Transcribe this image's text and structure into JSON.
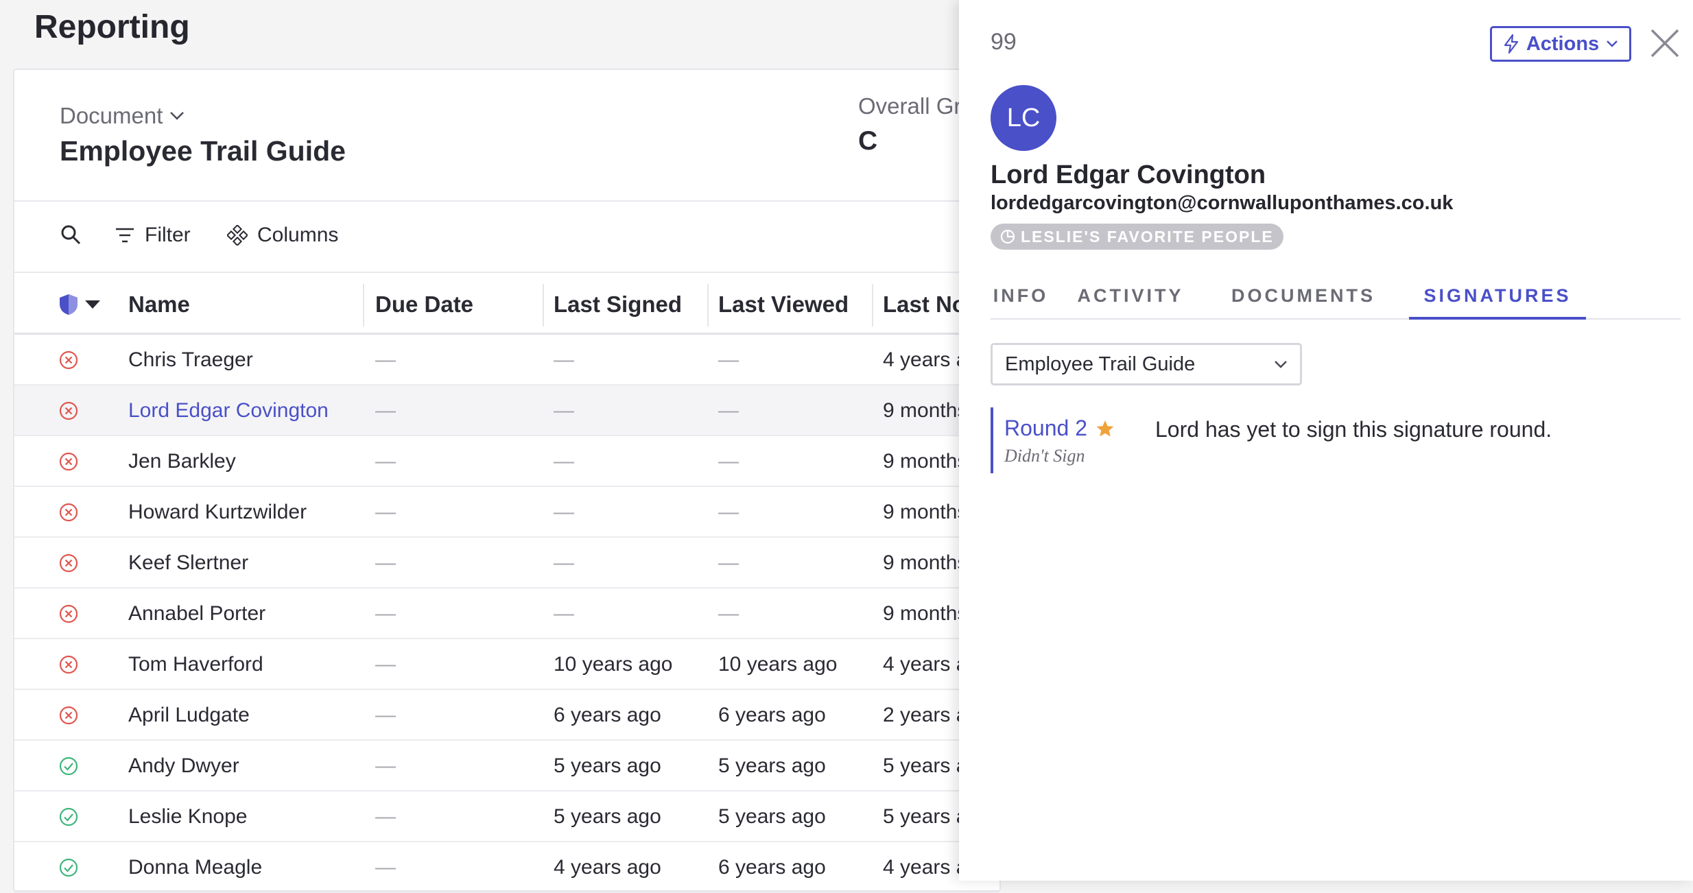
{
  "page": {
    "title": "Reporting"
  },
  "document": {
    "label": "Document",
    "title": "Employee Trail Guide",
    "grade_label": "Overall Gr",
    "grade_value": "C"
  },
  "toolbar": {
    "filter_label": "Filter",
    "columns_label": "Columns"
  },
  "table": {
    "columns": [
      "Name",
      "Due Date",
      "Last Signed",
      "Last Viewed",
      "Last No"
    ],
    "rows": [
      {
        "status": "unsigned",
        "name": "Chris Traeger",
        "due": "—",
        "signed": "—",
        "viewed": "—",
        "last": "4 years a"
      },
      {
        "status": "unsigned",
        "name": "Lord Edgar Covington",
        "due": "—",
        "signed": "—",
        "viewed": "—",
        "last": "9 months"
      },
      {
        "status": "unsigned",
        "name": "Jen Barkley",
        "due": "—",
        "signed": "—",
        "viewed": "—",
        "last": "9 months"
      },
      {
        "status": "unsigned",
        "name": "Howard Kurtzwilder",
        "due": "—",
        "signed": "—",
        "viewed": "—",
        "last": "9 months"
      },
      {
        "status": "unsigned",
        "name": "Keef Slertner",
        "due": "—",
        "signed": "—",
        "viewed": "—",
        "last": "9 months"
      },
      {
        "status": "unsigned",
        "name": "Annabel Porter",
        "due": "—",
        "signed": "—",
        "viewed": "—",
        "last": "9 months"
      },
      {
        "status": "unsigned",
        "name": "Tom Haverford",
        "due": "—",
        "signed": "10 years ago",
        "viewed": "10 years ago",
        "last": "4 years a"
      },
      {
        "status": "unsigned",
        "name": "April Ludgate",
        "due": "—",
        "signed": "6 years ago",
        "viewed": "6 years ago",
        "last": "2 years a"
      },
      {
        "status": "signed",
        "name": "Andy Dwyer",
        "due": "—",
        "signed": "5 years ago",
        "viewed": "5 years ago",
        "last": "5 years a"
      },
      {
        "status": "signed",
        "name": "Leslie Knope",
        "due": "—",
        "signed": "5 years ago",
        "viewed": "5 years ago",
        "last": "5 years a"
      },
      {
        "status": "signed",
        "name": "Donna Meagle",
        "due": "—",
        "signed": "4 years ago",
        "viewed": "6 years ago",
        "last": "4 years a"
      }
    ]
  },
  "panel": {
    "number": "99",
    "actions_label": "Actions",
    "avatar_initials": "LC",
    "name": "Lord Edgar Covington",
    "email": "lordedgarcovington@cornwalluponthames.co.uk",
    "group": "LESLIE'S FAVORITE PEOPLE",
    "tabs": [
      "INFO",
      "ACTIVITY",
      "DOCUMENTS",
      "SIGNATURES"
    ],
    "active_tab": "SIGNATURES",
    "document_select": "Employee Trail Guide",
    "round": {
      "title": "Round 2",
      "status": "Didn't Sign",
      "message": "Lord has yet to sign this signature round."
    }
  },
  "colors": {
    "accent": "#4a50c8",
    "error": "#e0564f",
    "success": "#3fb57c",
    "star": "#f0a23a"
  }
}
